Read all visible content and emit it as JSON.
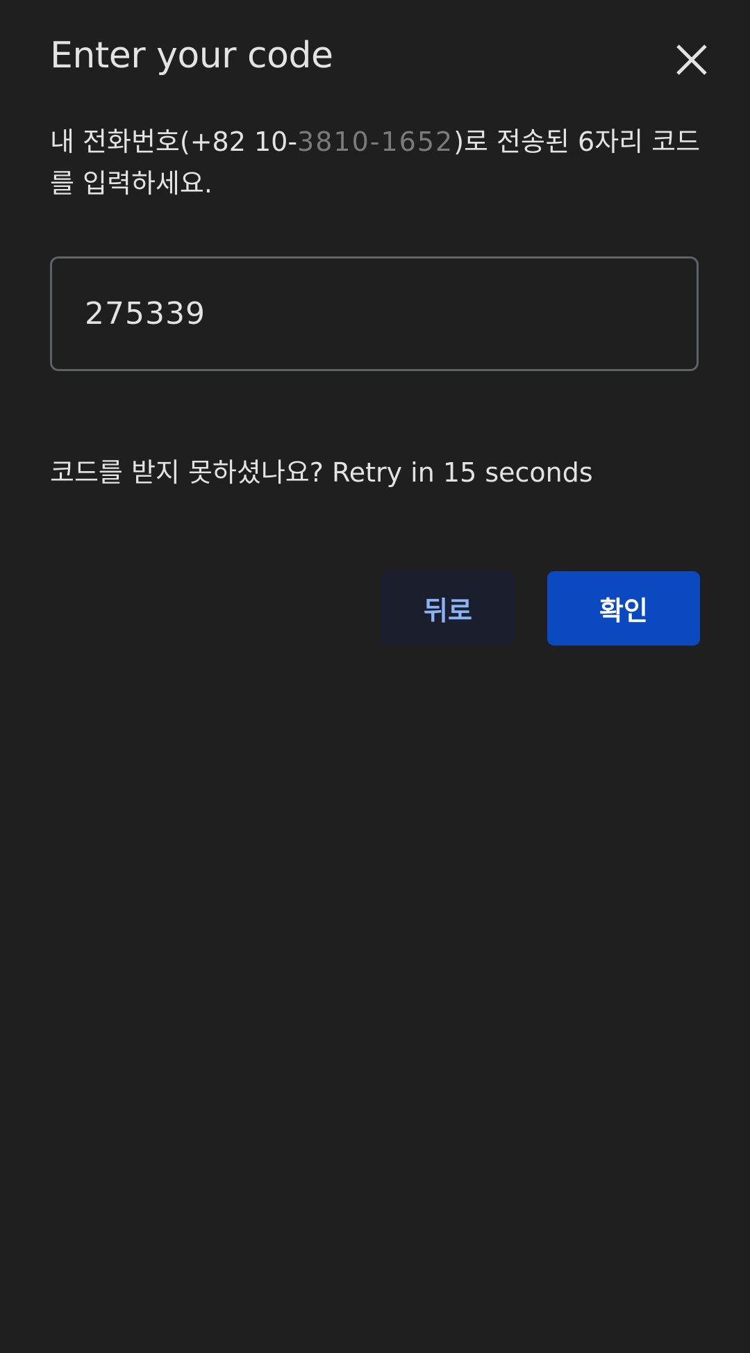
{
  "dialog": {
    "title": "Enter your code",
    "description_prefix": "내 전화번호(+82 10-",
    "masked_number": "3810-1652",
    "description_suffix": ")로 전송된 6자리 코드를 입력하세요.",
    "code_input": {
      "value": "275339",
      "placeholder": ""
    },
    "retry_text": "코드를 받지 못하셨나요? Retry in 15 seconds",
    "back_label": "뒤로",
    "confirm_label": "확인",
    "close_icon": "close-icon"
  },
  "colors": {
    "background": "#1f1f1f",
    "text": "#e3e3e3",
    "field_border": "#5f6368",
    "back_bg": "#1b1e2c",
    "back_text": "#8ab4f8",
    "confirm_bg": "#0b49c0",
    "confirm_text": "#ffffff"
  }
}
